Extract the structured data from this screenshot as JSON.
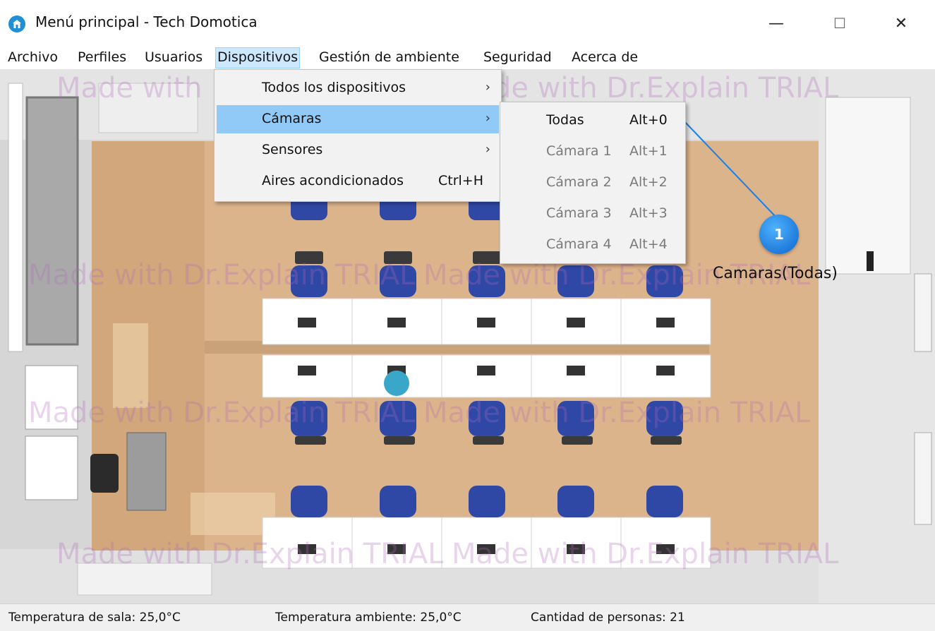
{
  "window": {
    "title": "Menú principal - Tech Domotica",
    "minimize_glyph": "—",
    "maximize_glyph": "☐",
    "close_glyph": "✕"
  },
  "menubar": {
    "items": [
      "Archivo",
      "Perfiles",
      "Usuarios",
      "Dispositivos",
      "Gestión de ambiente",
      "Seguridad",
      "Acerca de"
    ],
    "active": "Dispositivos"
  },
  "dispositivos_menu": {
    "items": [
      {
        "label": "Todos los dispositivos",
        "shortcut": "",
        "arrow": "›"
      },
      {
        "label": "Cámaras",
        "shortcut": "",
        "arrow": "›"
      },
      {
        "label": "Sensores",
        "shortcut": "",
        "arrow": "›"
      },
      {
        "label": "Aires acondicionados",
        "shortcut": "Ctrl+H",
        "arrow": ""
      }
    ],
    "highlighted": "Cámaras"
  },
  "camaras_submenu": {
    "items": [
      {
        "label": "Todas",
        "shortcut": "Alt+0",
        "enabled": true
      },
      {
        "label": "Cámara 1",
        "shortcut": "Alt+1",
        "enabled": false
      },
      {
        "label": "Cámara 2",
        "shortcut": "Alt+2",
        "enabled": false
      },
      {
        "label": "Cámara 3",
        "shortcut": "Alt+3",
        "enabled": false
      },
      {
        "label": "Cámara 4",
        "shortcut": "Alt+4",
        "enabled": false
      }
    ]
  },
  "callout": {
    "number": "1",
    "label": "Camaras(Todas)",
    "color": "#1a7fe6"
  },
  "watermark": "Made with Dr.Explain TRIAL",
  "statusbar": {
    "sala": "Temperatura de sala: 25,0°C",
    "ambiente": "Temperatura ambiente: 25,0°C",
    "personas": "Cantidad de personas: 21"
  },
  "colors": {
    "menu_highlight": "#91c9f7",
    "menubar_active": "#cce8ff",
    "floor": "#d9b48c",
    "chair": "#2f48a6"
  }
}
